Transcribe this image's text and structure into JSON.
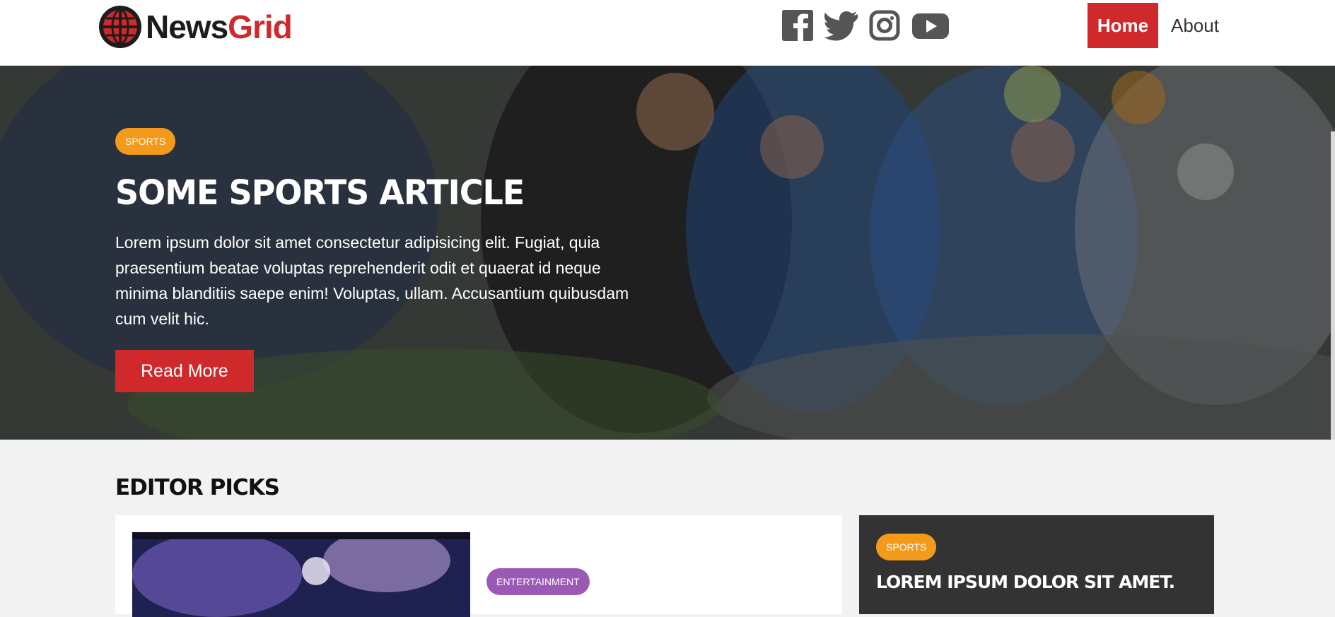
{
  "brand": {
    "name_part1": "News",
    "name_part2": "Grid",
    "accent_color": "#d0292b"
  },
  "social": [
    {
      "icon": "facebook-icon"
    },
    {
      "icon": "twitter-icon"
    },
    {
      "icon": "instagram-icon"
    },
    {
      "icon": "youtube-icon"
    }
  ],
  "nav": {
    "home": "Home",
    "about": "About"
  },
  "hero": {
    "tag": "SPORTS",
    "title": "SOME SPORTS ARTICLE",
    "text": "Lorem ipsum dolor sit amet consectetur adipisicing elit. Fugiat, quia praesentium beatae voluptas reprehenderit odit et quaerat id neque minima blanditiis saepe enim! Voluptas, ullam. Accusantium quibusdam cum velit hic.",
    "button": "Read More"
  },
  "editor_picks": {
    "heading": "EDITOR PICKS",
    "main_card": {
      "tag": "ENTERTAINMENT"
    },
    "side_card": {
      "tag": "SPORTS",
      "title": "LOREM IPSUM DOLOR SIT AMET."
    }
  },
  "colors": {
    "sports": "#f39a1b",
    "entertainment": "#9b59b6",
    "dark_card": "#333333"
  }
}
